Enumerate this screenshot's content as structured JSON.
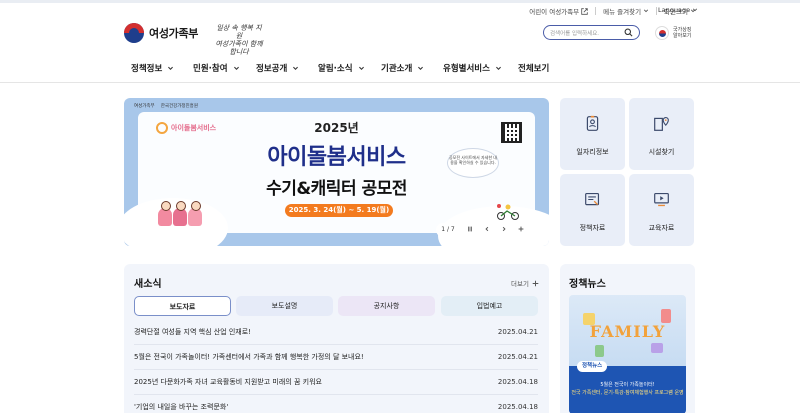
{
  "utility": {
    "kids_site": "어린이 여성가족부",
    "favorites": "메뉴 즐겨찾기",
    "font_size": "화면크기",
    "language": "Language"
  },
  "header": {
    "logo_text": "여성가족부",
    "slogan_line1": "일상 속 행복 지원",
    "slogan_line2": "여성가족이 함께 합니다",
    "search_placeholder": "검색어를 입력하세요.",
    "national_symbol_line1": "국가상징",
    "national_symbol_line2": "알아보기"
  },
  "gnb": [
    {
      "label": "정책정보",
      "has_dropdown": true
    },
    {
      "label": "민원·참여",
      "has_dropdown": true
    },
    {
      "label": "정보공개",
      "has_dropdown": true
    },
    {
      "label": "알림·소식",
      "has_dropdown": true
    },
    {
      "label": "기관소개",
      "has_dropdown": true
    },
    {
      "label": "유형별서비스",
      "has_dropdown": true
    },
    {
      "label": "전체보기",
      "has_dropdown": false
    }
  ],
  "banner": {
    "org1": "여성가족부",
    "org2": "한국건강가정진흥원",
    "service": "아이돌봄서비스",
    "year": "2025년",
    "title1": "아이돌봄서비스",
    "title2": "수기&캐릭터 공모전",
    "period": "2025. 3. 24(월) ~ 5. 19(월)",
    "qr_note": "공모전 사이트에서 자세한 내용을 확인하실 수 있습니다.",
    "pager": "1 / 7",
    "colors": {
      "frame": "#a8c7ea",
      "title": "#1f2f8a",
      "date_pill": "#f37b1f"
    }
  },
  "quick_links": [
    {
      "label": "일자리정보",
      "icon": "job-id-card-icon"
    },
    {
      "label": "시설찾기",
      "icon": "facility-map-pin-icon"
    },
    {
      "label": "정책자료",
      "icon": "policy-document-icon"
    },
    {
      "label": "교육자료",
      "icon": "education-video-icon"
    }
  ],
  "news": {
    "title": "새소식",
    "more": "더보기",
    "tabs": [
      {
        "label": "보도자료",
        "active": true
      },
      {
        "label": "보도설명",
        "active": false
      },
      {
        "label": "공지사항",
        "active": false
      },
      {
        "label": "입법예고",
        "active": false
      }
    ],
    "items": [
      {
        "title": "경력단절 여성들 지역 핵심 산업 인재로!",
        "date": "2025.04.21"
      },
      {
        "title": "5월은 전국이 가족놀이터! 가족센터에서 가족과 함께 행복한 가정의 달 보내요!",
        "date": "2025.04.21"
      },
      {
        "title": "2025년 다문화가족 자녀 교육활동비 지원받고 미래의 꿈 키워요",
        "date": "2025.04.18"
      },
      {
        "title": "'기업의 내일을 바꾸는 조력문화'",
        "date": "2025.04.18"
      }
    ]
  },
  "policy_news": {
    "title": "정책뉴스",
    "thumb_word": "FAMILY",
    "thumb_tag": "정책뉴스",
    "thumb_line1": "5월은 전국이 가족놀이터!",
    "thumb_line2": "전국 가족센터, 문기·특강·참여체험행사 프로그램 운영"
  }
}
